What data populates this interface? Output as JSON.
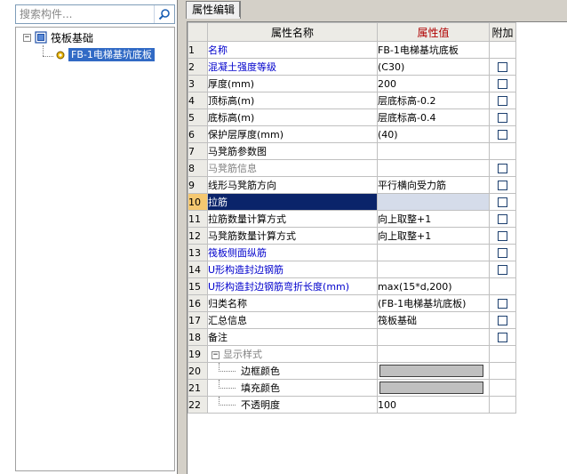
{
  "search": {
    "placeholder": "搜索构件..."
  },
  "tree": {
    "root_label": "筏板基础",
    "child_label": "FB-1电梯基坑底板"
  },
  "tabs": [
    {
      "label": "属性编辑"
    }
  ],
  "grid": {
    "headers": {
      "name": "属性名称",
      "value": "属性值",
      "extra": "附加"
    },
    "rows": [
      {
        "n": "1",
        "name": "名称",
        "value": "FB-1电梯基坑底板",
        "style": "blue",
        "chk": false
      },
      {
        "n": "2",
        "name": "混凝土强度等级",
        "value": "(C30)",
        "style": "blue",
        "chk": true
      },
      {
        "n": "3",
        "name": "厚度(mm)",
        "value": "200",
        "style": "",
        "chk": true
      },
      {
        "n": "4",
        "name": "顶标高(m)",
        "value": "层底标高-0.2",
        "style": "",
        "chk": true
      },
      {
        "n": "5",
        "name": "底标高(m)",
        "value": "层底标高-0.4",
        "style": "",
        "chk": true
      },
      {
        "n": "6",
        "name": "保护层厚度(mm)",
        "value": "(40)",
        "style": "",
        "chk": true
      },
      {
        "n": "7",
        "name": "马凳筋参数图",
        "value": "",
        "style": "",
        "chk": false
      },
      {
        "n": "8",
        "name": "马凳筋信息",
        "value": "",
        "style": "gray",
        "chk": true
      },
      {
        "n": "9",
        "name": "线形马凳筋方向",
        "value": "平行横向受力筋",
        "style": "",
        "chk": true
      },
      {
        "n": "10",
        "name": "拉筋",
        "value": "",
        "style": "selected",
        "chk": true
      },
      {
        "n": "11",
        "name": "拉筋数量计算方式",
        "value": "向上取整+1",
        "style": "",
        "chk": true
      },
      {
        "n": "12",
        "name": "马凳筋数量计算方式",
        "value": "向上取整+1",
        "style": "",
        "chk": true
      },
      {
        "n": "13",
        "name": "筏板侧面纵筋",
        "value": "",
        "style": "blue",
        "chk": true
      },
      {
        "n": "14",
        "name": "U形构造封边钢筋",
        "value": "",
        "style": "blue",
        "chk": true
      },
      {
        "n": "15",
        "name": "U形构造封边钢筋弯折长度(mm)",
        "value": "max(15*d,200)",
        "style": "blue",
        "chk": false
      },
      {
        "n": "16",
        "name": "归类名称",
        "value": "(FB-1电梯基坑底板)",
        "style": "",
        "chk": true
      },
      {
        "n": "17",
        "name": "汇总信息",
        "value": "筏板基础",
        "style": "",
        "chk": true
      },
      {
        "n": "18",
        "name": "备注",
        "value": "",
        "style": "",
        "chk": true
      },
      {
        "n": "19",
        "name": "显示样式",
        "value": "",
        "style": "section",
        "chk": false
      },
      {
        "n": "20",
        "name": "边框颜色",
        "value": "",
        "style": "sub-color",
        "chk": false
      },
      {
        "n": "21",
        "name": "填充颜色",
        "value": "",
        "style": "sub-color",
        "chk": false
      },
      {
        "n": "22",
        "name": "不透明度",
        "value": "100",
        "style": "sub",
        "chk": false
      }
    ]
  },
  "colors": {
    "selection": "#0a246a",
    "header_value_bg": "#f5c870",
    "header_value_text": "#b00000",
    "link_blue": "#0000cc",
    "swatch": "#c0c0c0"
  }
}
